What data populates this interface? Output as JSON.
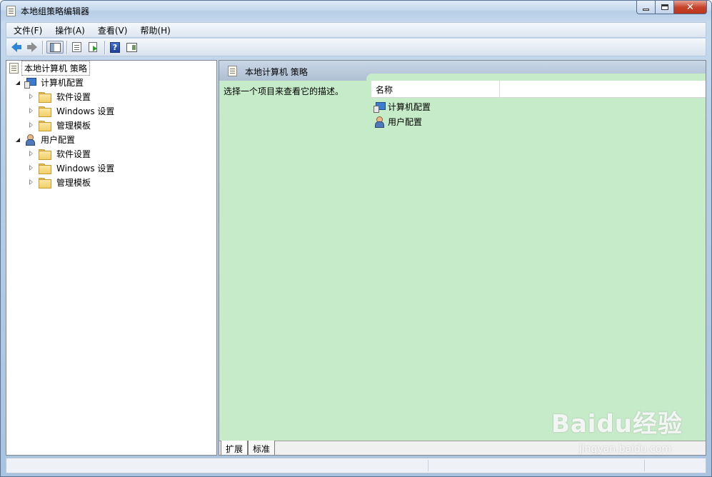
{
  "window": {
    "title": "本地组策略编辑器",
    "controls": {
      "minimize": "minimize",
      "maximize": "maximize",
      "close": "✕"
    }
  },
  "menu": [
    "文件(F)",
    "操作(A)",
    "查看(V)",
    "帮助(H)"
  ],
  "toolbar": {
    "icons": [
      "back-arrow-icon",
      "forward-arrow-icon",
      "show-tree-icon",
      "properties-icon",
      "export-list-icon",
      "help-icon",
      "action-pane-icon"
    ],
    "help_glyph": "?"
  },
  "tree": {
    "root": "本地计算机 策略",
    "nodes": [
      {
        "label": "计算机配置",
        "icon": "computer-config-icon",
        "expanded": true,
        "children": [
          "软件设置",
          "Windows 设置",
          "管理模板"
        ]
      },
      {
        "label": "用户配置",
        "icon": "user-config-icon",
        "expanded": true,
        "children": [
          "软件设置",
          "Windows 设置",
          "管理模板"
        ]
      }
    ]
  },
  "details": {
    "header_title": "本地计算机 策略",
    "description": "选择一个项目来查看它的描述。",
    "column_name": "名称",
    "items": [
      "计算机配置",
      "用户配置"
    ]
  },
  "tabs": [
    "扩展",
    "标准"
  ],
  "watermark": {
    "brand": "Baidu经验",
    "site": "jingyan.baidu.com"
  },
  "colors": {
    "details_bg": "#c6ebc9",
    "accent_blue": "#2f86d6",
    "title_bar": "#c6d9ee"
  }
}
